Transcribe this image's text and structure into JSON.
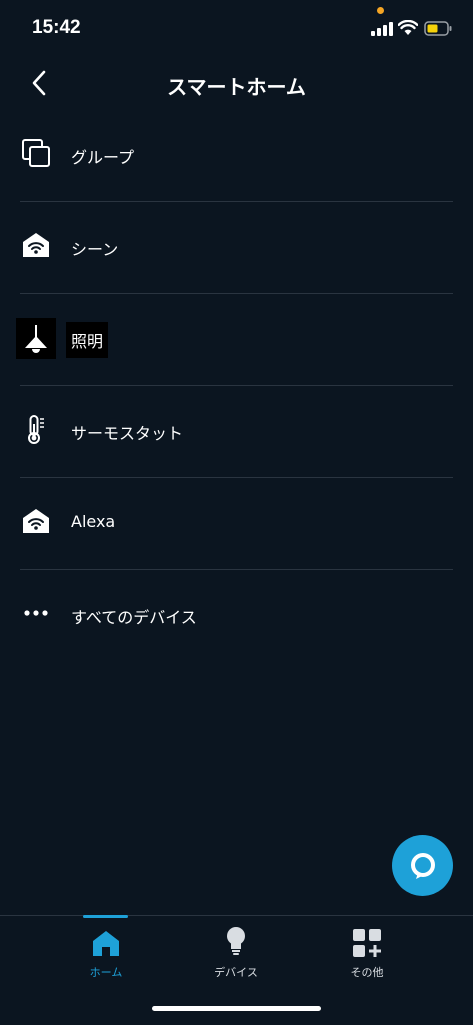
{
  "status_bar": {
    "time": "15:42"
  },
  "header": {
    "title": "スマートホーム"
  },
  "list": [
    {
      "label": "グループ",
      "icon": "group-icon"
    },
    {
      "label": "シーン",
      "icon": "scene-icon"
    },
    {
      "label": "照明",
      "icon": "light-icon"
    },
    {
      "label": "サーモスタット",
      "icon": "thermostat-icon"
    },
    {
      "label": "Alexa",
      "icon": "alexa-home-icon"
    },
    {
      "label": "すべてのデバイス",
      "icon": "more-dots-icon"
    }
  ],
  "tabs": [
    {
      "label": "ホーム",
      "icon": "home-icon",
      "active": true
    },
    {
      "label": "デバイス",
      "icon": "bulb-icon",
      "active": false
    },
    {
      "label": "その他",
      "icon": "grid-plus-icon",
      "active": false
    }
  ],
  "colors": {
    "accent": "#1ea1d8",
    "background": "#0b1520",
    "divider": "#2a3440",
    "notification_dot": "#f5a524",
    "battery": "#f5d20a"
  }
}
